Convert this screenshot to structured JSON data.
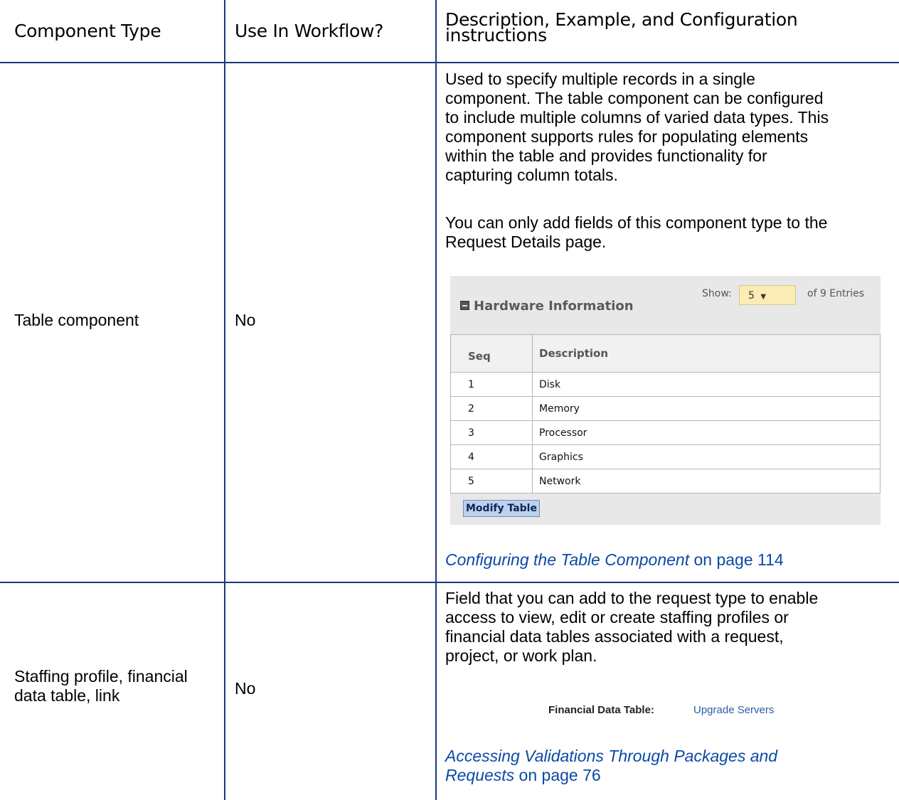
{
  "headers": {
    "component_type": "Component Type",
    "use_in_workflow": "Use In Workflow?",
    "description_line1": "Description, Example, and Configuration",
    "description_line2": "instructions"
  },
  "rows": [
    {
      "component_type": "Table component",
      "use_in_workflow": "No",
      "description_lines": [
        "Used to specify multiple records in a single",
        "component. The table component can be configured",
        "to include multiple columns of varied data types. This",
        "component supports rules for populating elements",
        "within the table and provides functionality for",
        "capturing column totals."
      ],
      "note_lines": [
        "You can only add fields of this component type to the",
        "Request Details page."
      ],
      "example_widget": {
        "title": "Hardware Information",
        "show_label": "Show:",
        "show_value": "5",
        "entries_text": "of 9 Entries",
        "columns": [
          "Seq",
          "Description"
        ],
        "rows": [
          [
            "1",
            "Disk"
          ],
          [
            "2",
            "Memory"
          ],
          [
            "3",
            "Processor"
          ],
          [
            "4",
            "Graphics"
          ],
          [
            "5",
            "Network"
          ]
        ],
        "button_label": "Modify Table"
      },
      "link_text": "Configuring the Table Component",
      "link_suffix": " on page 114"
    },
    {
      "component_type_line1": "Staffing profile, financial",
      "component_type_line2": "data table, link",
      "use_in_workflow": "No",
      "description_lines": [
        "Field that you can add to the request type to enable",
        "access to view, edit or create staffing profiles or",
        "financial data tables associated with a request,",
        "project, or work plan."
      ],
      "example_label": "Financial Data Table:",
      "example_value": "Upgrade Servers",
      "link_line1": "Accessing Validations Through Packages and",
      "link_line2": "Requests",
      "link_suffix": " on page 76"
    }
  ],
  "colors": {
    "rule": "#1a3a7a",
    "link": "#0b49a6",
    "select_bg": "#fbecb5",
    "button_bg": "#bcd1ec"
  }
}
